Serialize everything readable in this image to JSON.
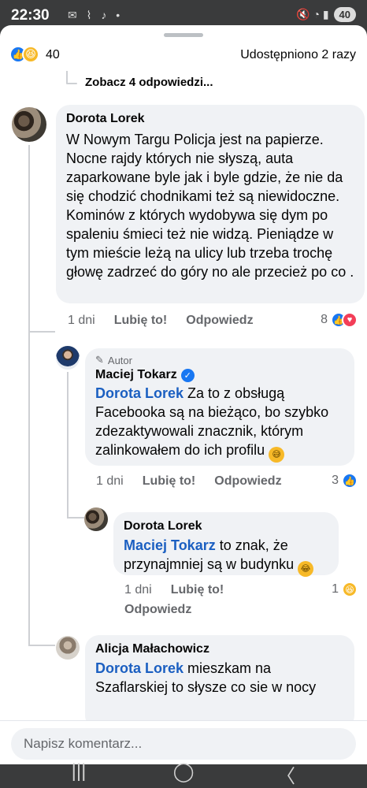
{
  "status_bar": {
    "time": "22:30",
    "notification_icons": "✉ ⌇ ♪ •",
    "right_icons": "🔇 ◔ ▮",
    "battery": "40"
  },
  "summary": {
    "reaction_count": "40",
    "shares": "Udostępniono 2 razy"
  },
  "see_replies": "Zobacz 4 odpowiedzi...",
  "comments": [
    {
      "author": "Dorota Lorek",
      "text": "W Nowym Targu Policja jest na papierze. Nocne rajdy których nie słyszą, auta zaparkowane byle jak i byle gdzie, że nie da się chodzić chodnikami też są niewidoczne. Kominów z których wydobywa się dym po spaleniu śmieci też nie widzą. Pieniądze w tym mieście leżą na ulicy lub trzeba trochę głowę zadrzeć do góry no ale przecież po co .",
      "time": "1 dni",
      "like": "Lubię to!",
      "reply": "Odpowiedz",
      "reactions": "8"
    },
    {
      "badge": "Autor",
      "author": "Maciej Tokarz",
      "mention": "Dorota Lorek",
      "text": " Za to z obsługą Facebooka są na bieżąco, bo szybko zdezaktywowali znacznik, którym zalinkowałem do ich profilu ",
      "time": "1 dni",
      "like": "Lubię to!",
      "reply": "Odpowiedz",
      "reactions": "3"
    },
    {
      "author": "Dorota Lorek",
      "mention": "Maciej Tokarz",
      "text": " to znak, że przynajmniej są w budynku ",
      "time": "1 dni",
      "like": "Lubię to!",
      "reply": "Odpowiedz",
      "reactions": "1"
    },
    {
      "author": "Alicja Małachowicz",
      "mention": "Dorota Lorek",
      "text": " mieszkam na Szaflarskiej to słysze co sie w nocy"
    }
  ],
  "composer": {
    "placeholder": "Napisz komentarz..."
  },
  "nav": {
    "recent": "|||",
    "home": "◯",
    "back": "〈"
  },
  "icons": {
    "like": "👍",
    "haha": "😆",
    "love": "♥",
    "sweat": "😅",
    "laugh_cry": "😂"
  },
  "colors": {
    "accent": "#1877f2",
    "mention": "#1b5fc1",
    "bubble": "#f0f2f5"
  }
}
